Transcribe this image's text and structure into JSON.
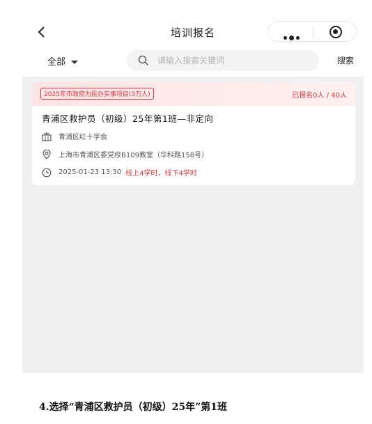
{
  "header": {
    "title": "培训报名",
    "back_icon": "chevron-left-icon",
    "more_icon": "more-dots-icon",
    "close_icon": "target-icon"
  },
  "filter": {
    "category_label": "全部",
    "search_placeholder": "请输入搜索关键词",
    "search_button": "搜索"
  },
  "courses": [
    {
      "project_tag": "2025年市政府为民办实事项目(3万人)",
      "enroll_count": "已报名0人 / 40人",
      "title": "青浦区救护员（初级）25年第1班—非定向",
      "organizer": "青浦区红十字会",
      "address": "上海市青浦区委党校B109教室（华科路158号）",
      "datetime": "2025-01-23 13:30",
      "hours": "线上4学时，线下4学时"
    }
  ],
  "caption": "4.选择“青浦区救护员（初级）25年”第1班",
  "colors": {
    "accent_red": "#d9363e",
    "list_background": "#f0f0f0"
  }
}
